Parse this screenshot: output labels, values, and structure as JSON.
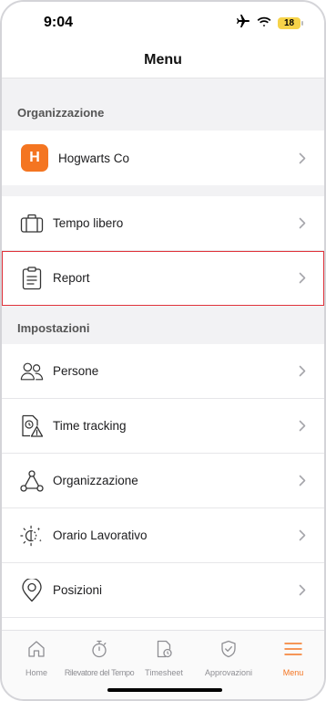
{
  "status_bar": {
    "time": "9:04",
    "battery": "18"
  },
  "nav": {
    "title": "Menu"
  },
  "sections": {
    "organization_header": "Organizzazione",
    "settings_header": "Impostazioni"
  },
  "organization": {
    "badge_letter": "H",
    "name": "Hogwarts Co"
  },
  "menu_items": {
    "time_off": "Tempo libero",
    "report": "Report"
  },
  "settings_items": {
    "people": "Persone",
    "time_tracking": "Time tracking",
    "organization": "Organizzazione",
    "work_schedule": "Orario Lavorativo",
    "locations": "Posizioni"
  },
  "tabs": {
    "home": "Home",
    "time_clock": "Rilevatore del Tempo",
    "timesheet": "Timesheet",
    "approvals": "Approvazioni",
    "menu": "Menu"
  },
  "colors": {
    "accent": "#f47521",
    "highlight": "#e0333b",
    "battery": "#f6d34a"
  }
}
